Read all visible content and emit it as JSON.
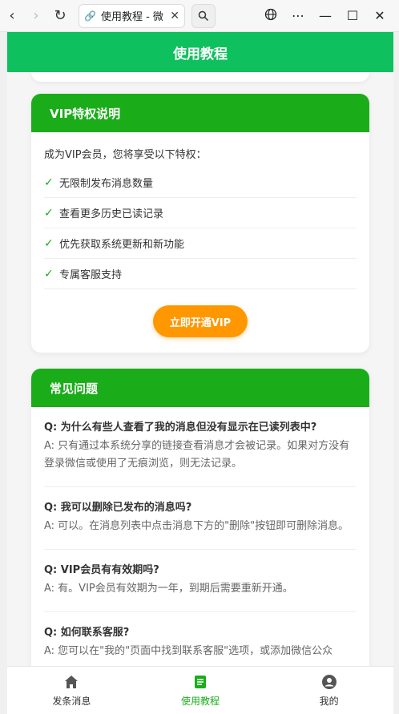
{
  "browser": {
    "tab_title": "使用教程 - 微",
    "tab_icon": "link-icon"
  },
  "app": {
    "title": "使用教程"
  },
  "vip": {
    "header": "VIP特权说明",
    "intro": "成为VIP会员，您将享受以下特权：",
    "check_mark": "✓",
    "privileges": [
      "无限制发布消息数量",
      "查看更多历史已读记录",
      "优先获取系统更新和新功能",
      "专属客服支持"
    ],
    "button": "立即开通VIP"
  },
  "faq": {
    "header": "常见问题",
    "items": [
      {
        "q": "Q: 为什么有些人查看了我的消息但没有显示在已读列表中?",
        "a": "A: 只有通过本系统分享的链接查看消息才会被记录。如果对方没有登录微信或使用了无痕浏览，则无法记录。"
      },
      {
        "q": "Q: 我可以删除已发布的消息吗?",
        "a": "A: 可以。在消息列表中点击消息下方的\"删除\"按钮即可删除消息。"
      },
      {
        "q": "Q: VIP会员有有效期吗?",
        "a": "A: 有。VIP会员有效期为一年，到期后需要重新开通。"
      },
      {
        "q": "Q: 如何联系客服?",
        "a": "A: 您可以在\"我的\"页面中找到联系客服\"选项，或添加微信公众"
      }
    ]
  },
  "nav": {
    "items": [
      {
        "label": "发条消息",
        "icon": "home-icon"
      },
      {
        "label": "使用教程",
        "icon": "document-icon"
      },
      {
        "label": "我的",
        "icon": "user-icon"
      }
    ]
  },
  "colors": {
    "brand_green": "#0fc05e",
    "header_green": "#1aad19",
    "vip_orange": "#ff9800"
  }
}
